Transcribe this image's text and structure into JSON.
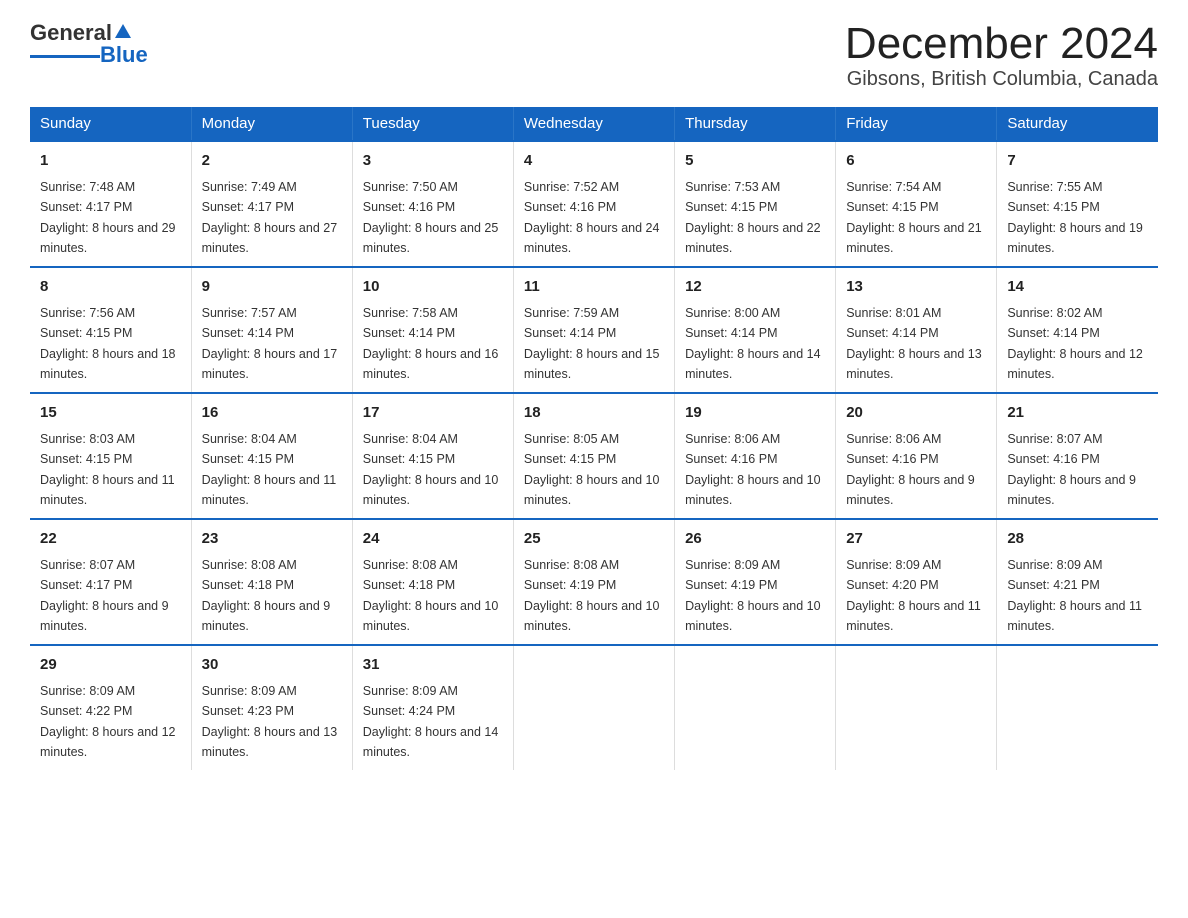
{
  "header": {
    "logo_general": "General",
    "logo_blue": "Blue",
    "title": "December 2024",
    "subtitle": "Gibsons, British Columbia, Canada"
  },
  "days_of_week": [
    "Sunday",
    "Monday",
    "Tuesday",
    "Wednesday",
    "Thursday",
    "Friday",
    "Saturday"
  ],
  "weeks": [
    [
      {
        "day": "1",
        "sunrise": "7:48 AM",
        "sunset": "4:17 PM",
        "daylight": "8 hours and 29 minutes."
      },
      {
        "day": "2",
        "sunrise": "7:49 AM",
        "sunset": "4:17 PM",
        "daylight": "8 hours and 27 minutes."
      },
      {
        "day": "3",
        "sunrise": "7:50 AM",
        "sunset": "4:16 PM",
        "daylight": "8 hours and 25 minutes."
      },
      {
        "day": "4",
        "sunrise": "7:52 AM",
        "sunset": "4:16 PM",
        "daylight": "8 hours and 24 minutes."
      },
      {
        "day": "5",
        "sunrise": "7:53 AM",
        "sunset": "4:15 PM",
        "daylight": "8 hours and 22 minutes."
      },
      {
        "day": "6",
        "sunrise": "7:54 AM",
        "sunset": "4:15 PM",
        "daylight": "8 hours and 21 minutes."
      },
      {
        "day": "7",
        "sunrise": "7:55 AM",
        "sunset": "4:15 PM",
        "daylight": "8 hours and 19 minutes."
      }
    ],
    [
      {
        "day": "8",
        "sunrise": "7:56 AM",
        "sunset": "4:15 PM",
        "daylight": "8 hours and 18 minutes."
      },
      {
        "day": "9",
        "sunrise": "7:57 AM",
        "sunset": "4:14 PM",
        "daylight": "8 hours and 17 minutes."
      },
      {
        "day": "10",
        "sunrise": "7:58 AM",
        "sunset": "4:14 PM",
        "daylight": "8 hours and 16 minutes."
      },
      {
        "day": "11",
        "sunrise": "7:59 AM",
        "sunset": "4:14 PM",
        "daylight": "8 hours and 15 minutes."
      },
      {
        "day": "12",
        "sunrise": "8:00 AM",
        "sunset": "4:14 PM",
        "daylight": "8 hours and 14 minutes."
      },
      {
        "day": "13",
        "sunrise": "8:01 AM",
        "sunset": "4:14 PM",
        "daylight": "8 hours and 13 minutes."
      },
      {
        "day": "14",
        "sunrise": "8:02 AM",
        "sunset": "4:14 PM",
        "daylight": "8 hours and 12 minutes."
      }
    ],
    [
      {
        "day": "15",
        "sunrise": "8:03 AM",
        "sunset": "4:15 PM",
        "daylight": "8 hours and 11 minutes."
      },
      {
        "day": "16",
        "sunrise": "8:04 AM",
        "sunset": "4:15 PM",
        "daylight": "8 hours and 11 minutes."
      },
      {
        "day": "17",
        "sunrise": "8:04 AM",
        "sunset": "4:15 PM",
        "daylight": "8 hours and 10 minutes."
      },
      {
        "day": "18",
        "sunrise": "8:05 AM",
        "sunset": "4:15 PM",
        "daylight": "8 hours and 10 minutes."
      },
      {
        "day": "19",
        "sunrise": "8:06 AM",
        "sunset": "4:16 PM",
        "daylight": "8 hours and 10 minutes."
      },
      {
        "day": "20",
        "sunrise": "8:06 AM",
        "sunset": "4:16 PM",
        "daylight": "8 hours and 9 minutes."
      },
      {
        "day": "21",
        "sunrise": "8:07 AM",
        "sunset": "4:16 PM",
        "daylight": "8 hours and 9 minutes."
      }
    ],
    [
      {
        "day": "22",
        "sunrise": "8:07 AM",
        "sunset": "4:17 PM",
        "daylight": "8 hours and 9 minutes."
      },
      {
        "day": "23",
        "sunrise": "8:08 AM",
        "sunset": "4:18 PM",
        "daylight": "8 hours and 9 minutes."
      },
      {
        "day": "24",
        "sunrise": "8:08 AM",
        "sunset": "4:18 PM",
        "daylight": "8 hours and 10 minutes."
      },
      {
        "day": "25",
        "sunrise": "8:08 AM",
        "sunset": "4:19 PM",
        "daylight": "8 hours and 10 minutes."
      },
      {
        "day": "26",
        "sunrise": "8:09 AM",
        "sunset": "4:19 PM",
        "daylight": "8 hours and 10 minutes."
      },
      {
        "day": "27",
        "sunrise": "8:09 AM",
        "sunset": "4:20 PM",
        "daylight": "8 hours and 11 minutes."
      },
      {
        "day": "28",
        "sunrise": "8:09 AM",
        "sunset": "4:21 PM",
        "daylight": "8 hours and 11 minutes."
      }
    ],
    [
      {
        "day": "29",
        "sunrise": "8:09 AM",
        "sunset": "4:22 PM",
        "daylight": "8 hours and 12 minutes."
      },
      {
        "day": "30",
        "sunrise": "8:09 AM",
        "sunset": "4:23 PM",
        "daylight": "8 hours and 13 minutes."
      },
      {
        "day": "31",
        "sunrise": "8:09 AM",
        "sunset": "4:24 PM",
        "daylight": "8 hours and 14 minutes."
      },
      null,
      null,
      null,
      null
    ]
  ]
}
